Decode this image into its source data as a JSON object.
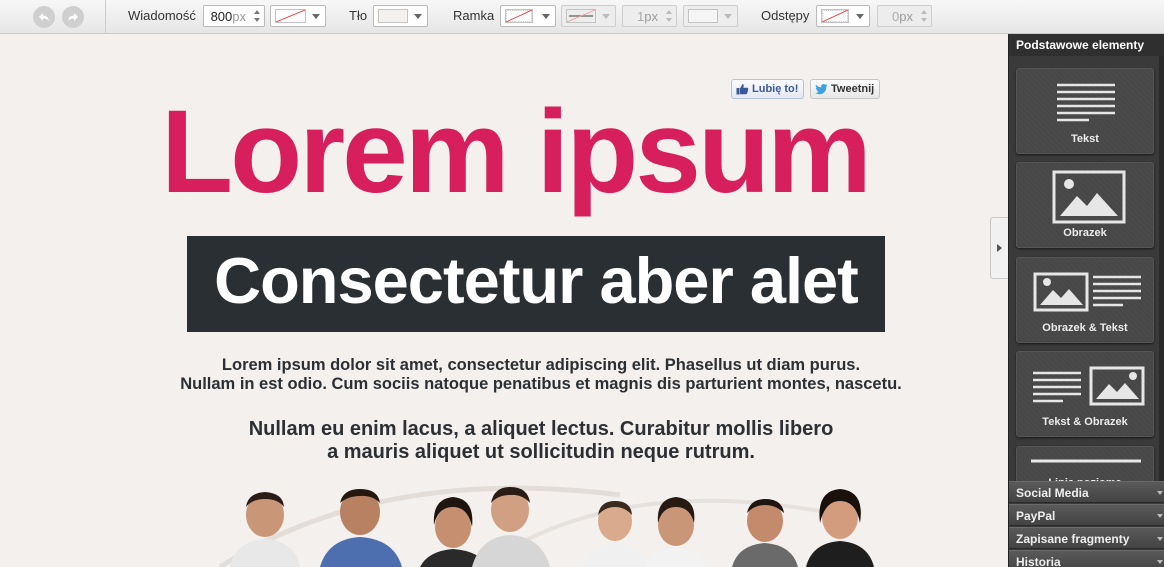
{
  "toolbar": {
    "message_label": "Wiadomość",
    "message_width_value": "800",
    "unit": "px",
    "background_label": "Tło",
    "border_label": "Ramka",
    "border_width_value": "1",
    "spacing_label": "Odstępy",
    "spacing_value": "0"
  },
  "canvas": {
    "like_label": "Lubię to!",
    "tweet_label": "Tweetnij",
    "headline": "Lorem ipsum",
    "subheadline": "Consectetur aber alet",
    "paragraph1_line1": "Lorem ipsum dolor sit amet, consectetur adipiscing elit. Phasellus ut diam purus.",
    "paragraph1_line2": "Nullam in est odio. Cum sociis natoque penatibus et magnis dis parturient montes, nascetu.",
    "paragraph2_line1": "Nullam eu enim lacus, a aliquet lectus. Curabitur mollis libero",
    "paragraph2_line2": "a mauris aliquet ut sollicitudin neque rutrum.",
    "headline_color": "#d81f5d",
    "subhead_bg": "#2a2f33"
  },
  "sidebar": {
    "header": "Podstawowe elementy",
    "tiles": [
      "Tekst",
      "Obrazek",
      "Obrazek & Tekst",
      "Tekst & Obrazek",
      "Linia pozioma"
    ],
    "accordion": [
      "Social Media",
      "PayPal",
      "Zapisane fragmenty",
      "Historia"
    ]
  }
}
